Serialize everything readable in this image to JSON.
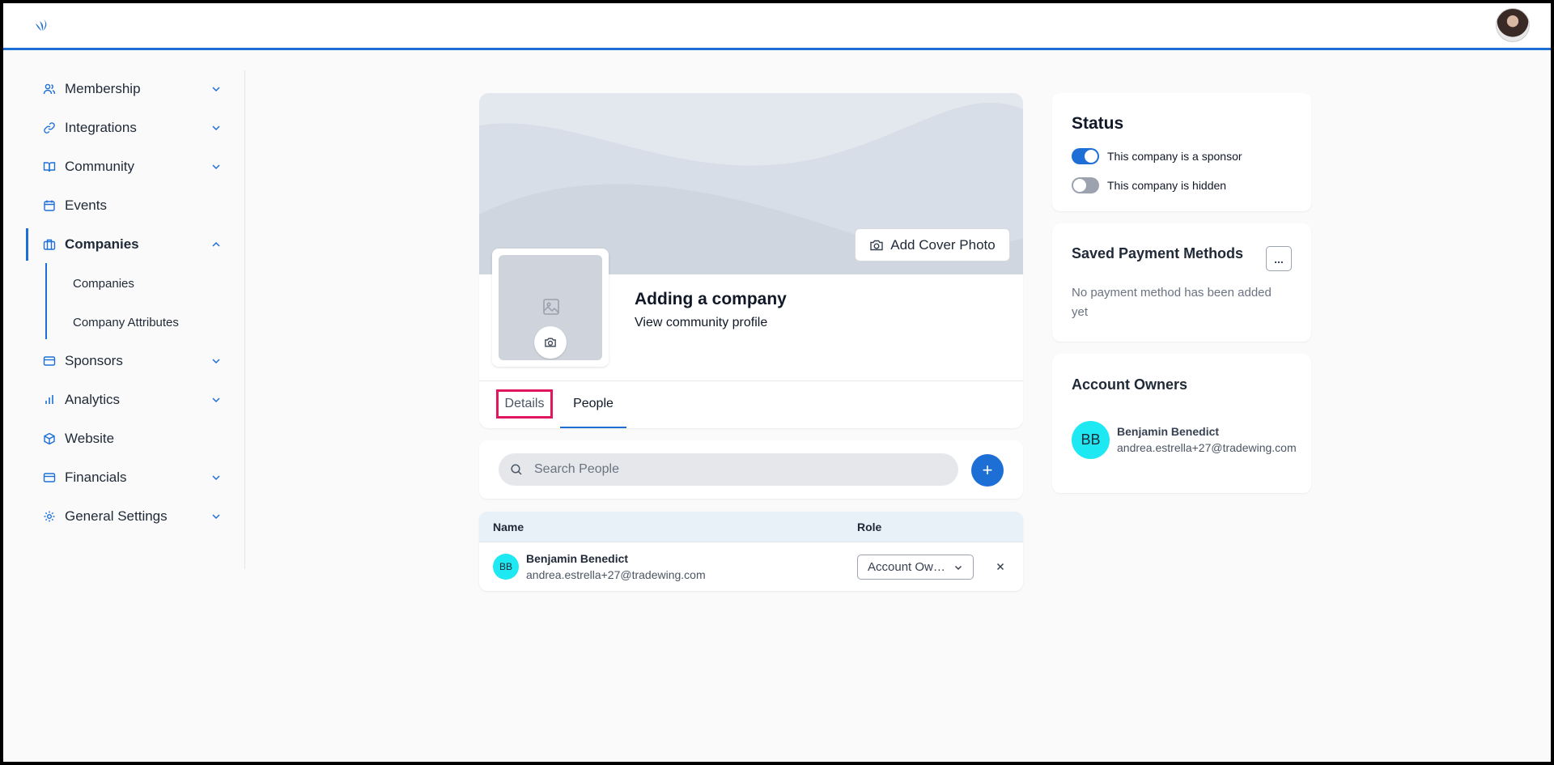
{
  "sidebar": {
    "items": [
      {
        "label": "Membership",
        "icon": "users-icon"
      },
      {
        "label": "Integrations",
        "icon": "link-icon"
      },
      {
        "label": "Community",
        "icon": "book-icon"
      },
      {
        "label": "Events",
        "icon": "calendar-icon"
      },
      {
        "label": "Companies",
        "icon": "briefcase-icon"
      },
      {
        "label": "Sponsors",
        "icon": "card-icon"
      },
      {
        "label": "Analytics",
        "icon": "bar-chart-icon"
      },
      {
        "label": "Website",
        "icon": "cube-icon"
      },
      {
        "label": "Financials",
        "icon": "card-icon"
      },
      {
        "label": "General Settings",
        "icon": "gear-icon"
      }
    ],
    "sub_items": [
      "Companies",
      "Company Attributes"
    ]
  },
  "profile": {
    "cover_button_label": "Add Cover Photo",
    "company_name": "Adding a company",
    "community_link": "View community profile"
  },
  "tabs": {
    "details": "Details",
    "people": "People"
  },
  "people": {
    "search_placeholder": "Search People",
    "add_label": "+",
    "columns": {
      "name": "Name",
      "role": "Role"
    },
    "rows": [
      {
        "initials": "BB",
        "name": "Benjamin Benedict",
        "email": "andrea.estrella+27@tradewing.com",
        "role": "Account Owner"
      }
    ]
  },
  "status": {
    "title": "Status",
    "toggles": [
      {
        "label": "This company is a sponsor",
        "on": true
      },
      {
        "label": "This company is hidden",
        "on": false
      }
    ]
  },
  "payment": {
    "title": "Saved Payment Methods",
    "more_label": "...",
    "empty_text": "No payment method has been added yet"
  },
  "owners": {
    "title": "Account Owners",
    "list": [
      {
        "initials": "BB",
        "name": "Benjamin Benedict",
        "email": "andrea.estrella+27@tradewing.com"
      }
    ]
  },
  "colors": {
    "accent": "#1d6fd6",
    "avatar_bg": "#1ee8f2",
    "highlight": "#e0175f"
  }
}
